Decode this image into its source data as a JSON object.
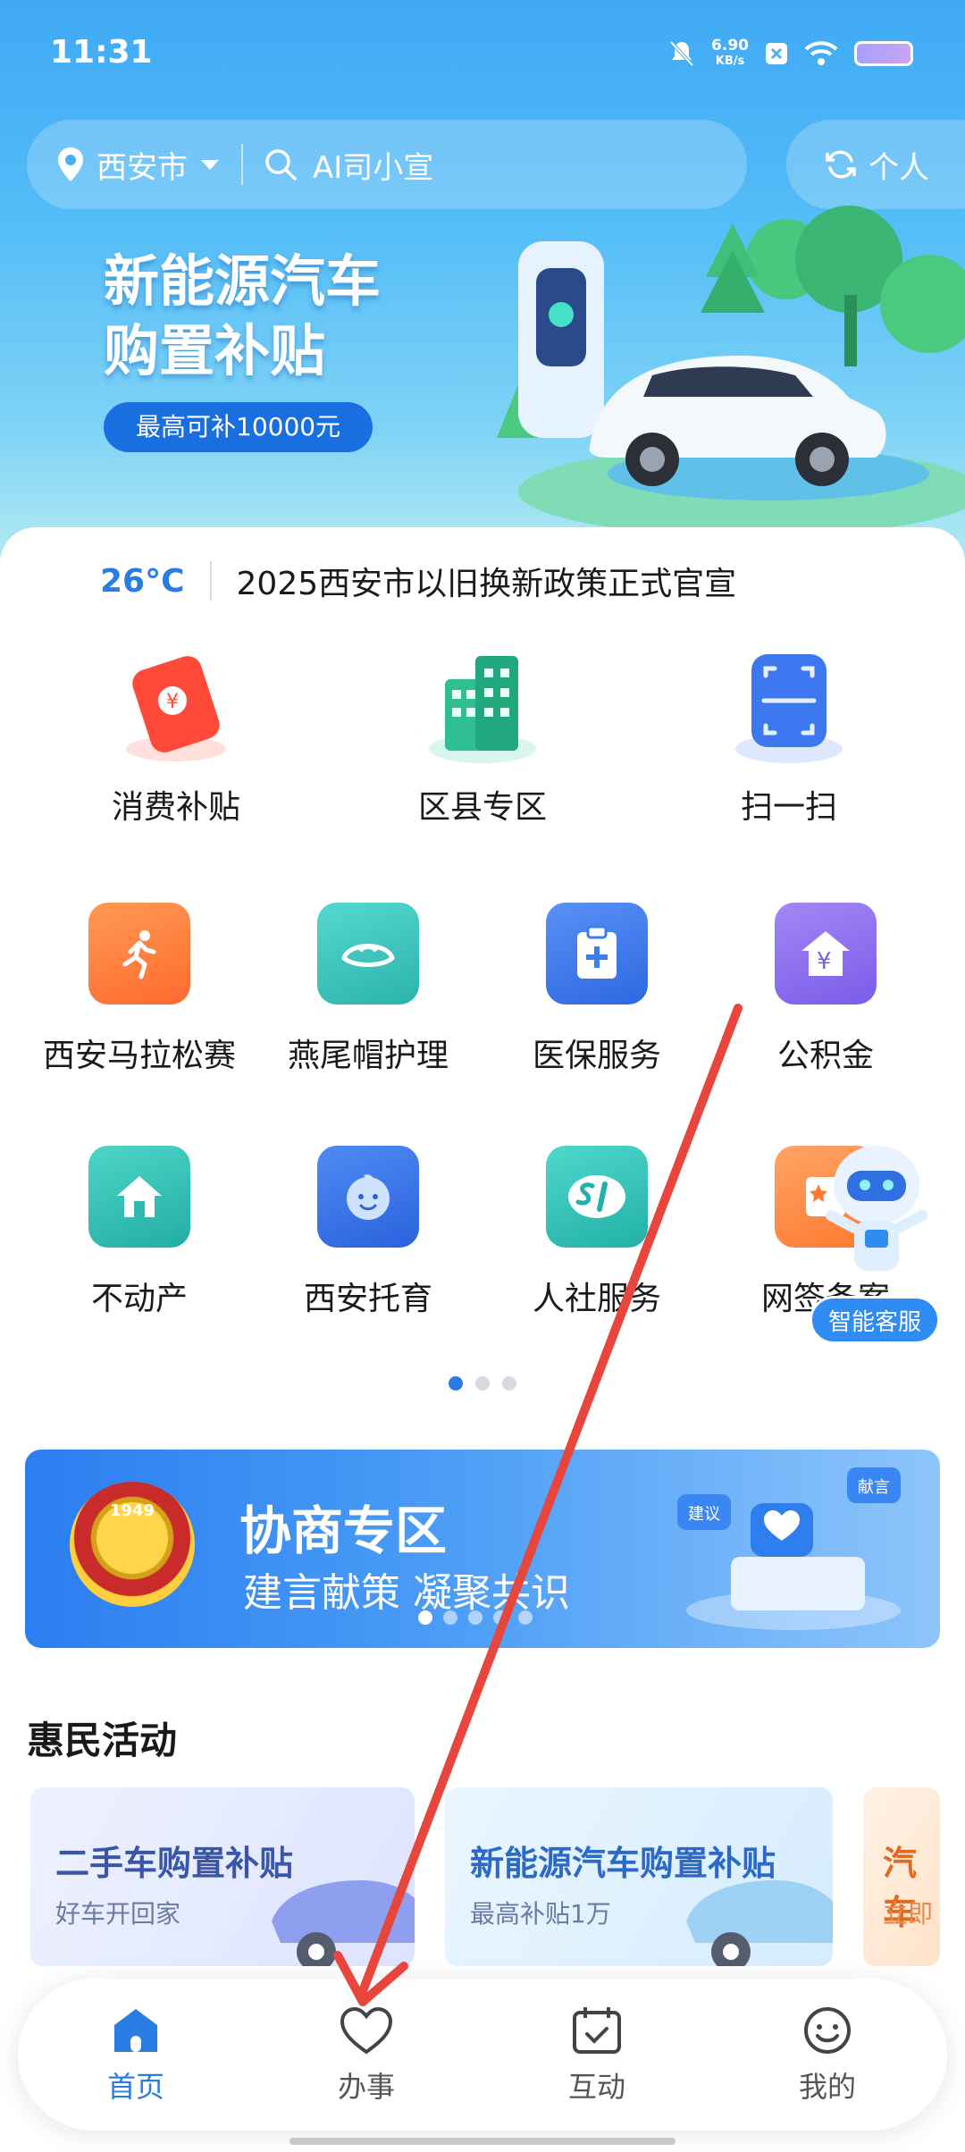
{
  "status_bar": {
    "time": "11:31",
    "net_speed_value": "6.90",
    "net_speed_unit": "KB/s"
  },
  "header": {
    "city": "西安市",
    "search_placeholder": "AI司小宣",
    "mode_label": "个人"
  },
  "banner": {
    "title_line1": "新能源汽车",
    "title_line2": "购置补贴",
    "tag": "最高可补10000元"
  },
  "ticker": {
    "temperature": "26°C",
    "headline": "2025西安市以旧换新政策正式官宣"
  },
  "big_services": [
    {
      "label": "消费补贴"
    },
    {
      "label": "区县专区"
    },
    {
      "label": "扫一扫"
    }
  ],
  "services_row1": [
    {
      "label": "西安马拉松赛",
      "color": "#ff7a3a"
    },
    {
      "label": "燕尾帽护理",
      "color": "#39c5c0"
    },
    {
      "label": "医保服务",
      "color": "#3b7ef0"
    },
    {
      "label": "公积金",
      "color": "#8a6bf0"
    }
  ],
  "services_row2": [
    {
      "label": "不动产",
      "color": "#33c0b6"
    },
    {
      "label": "西安托育",
      "color": "#3a76ea"
    },
    {
      "label": "人社服务",
      "color": "#36c4bb"
    },
    {
      "label": "网签备案",
      "color": "#ff8a3d"
    }
  ],
  "customer_service": {
    "label": "智能客服"
  },
  "promo": {
    "title": "协商专区",
    "subtitle": "建言献策  凝聚共识",
    "emblem_year": "1949",
    "bubble_1": "建议",
    "bubble_2": "献言"
  },
  "activities": {
    "section_title": "惠民活动",
    "cards": [
      {
        "title": "二手车购置补贴",
        "subtitle": "好车开回家"
      },
      {
        "title": "新能源汽车购置补贴",
        "subtitle": "最高补贴1万"
      },
      {
        "title": "汽车",
        "subtitle": "立即"
      }
    ]
  },
  "nav": {
    "items": [
      {
        "label": "首页",
        "active": true
      },
      {
        "label": "办事",
        "active": false
      },
      {
        "label": "互动",
        "active": false
      },
      {
        "label": "我的",
        "active": false
      }
    ]
  },
  "colors": {
    "accent": "#2a7be4",
    "arrow": "#e8453c"
  }
}
